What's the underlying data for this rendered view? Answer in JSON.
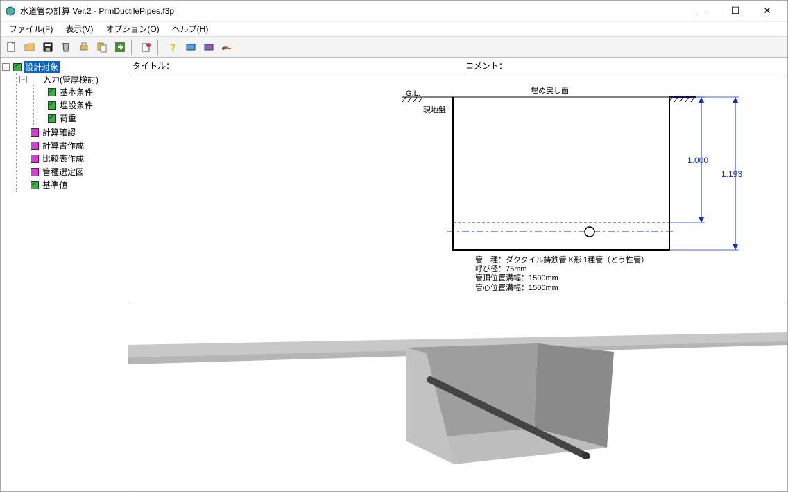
{
  "title": "水道管の計算 Ver.2 - PrmDuctilePipes.f3p",
  "menus": {
    "file": "ファイル(F)",
    "view": "表示(V)",
    "option": "オプション(O)",
    "help": "ヘルプ(H)"
  },
  "toolbar_icons": {
    "new": "new-icon",
    "open": "open-icon",
    "save": "save-icon",
    "delete": "delete-icon",
    "print": "print-icon",
    "export": "export-icon",
    "run": "run-icon",
    "opts": "options-icon",
    "help": "help-icon",
    "db1": "db1-icon",
    "db2": "db2-icon",
    "db3": "db3-icon"
  },
  "header": {
    "title_label": "タイトル：",
    "comment_label": "コメント："
  },
  "tree": {
    "root": "設計対象",
    "input": "入力(管厚検討)",
    "basic": "基本条件",
    "bury": "埋設条件",
    "load": "荷重",
    "calc_check": "計算確認",
    "report": "計算書作成",
    "compare": "比較表作成",
    "pipe_select": "管種選定図",
    "standard": "基準値"
  },
  "diagram": {
    "gl": "G.L.",
    "backfill": "埋め戻し面",
    "ground": "現地盤",
    "dim1": "1.000",
    "dim2": "1.193",
    "info_line1": "管　種：ダクタイル鋳鉄管 K形 1種管（とう性管）",
    "info_line2": "呼び径：75mm",
    "info_line3": "管頂位置溝幅：1500mm",
    "info_line4": "管心位置溝幅：1500mm"
  }
}
